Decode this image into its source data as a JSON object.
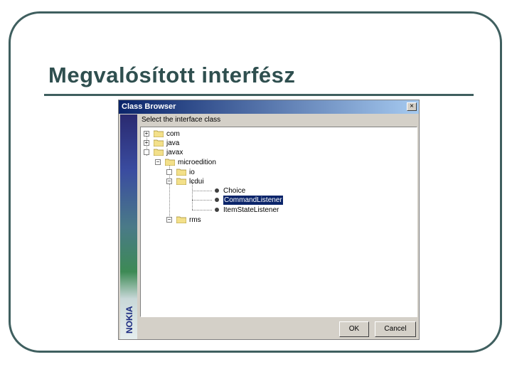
{
  "slide": {
    "title": "Megvalósított interfész"
  },
  "dialog": {
    "title": "Class Browser",
    "close_glyph": "×",
    "prompt": "Select the interface class",
    "brand": "NOKIA",
    "buttons": {
      "ok": "OK",
      "cancel": "Cancel"
    }
  },
  "tree": {
    "com": "com",
    "java": "java",
    "javax": "javax",
    "microedition": "microedition",
    "io": "io",
    "lcdui": "lcdui",
    "choice": "Choice",
    "command_listener": "CommandListener",
    "item_state_listener": "ItemStateListener",
    "rms": "rms"
  },
  "colors": {
    "selection": "#0a246a",
    "frame": "#3f5f5f",
    "dialog_bg": "#d4d0c8"
  }
}
